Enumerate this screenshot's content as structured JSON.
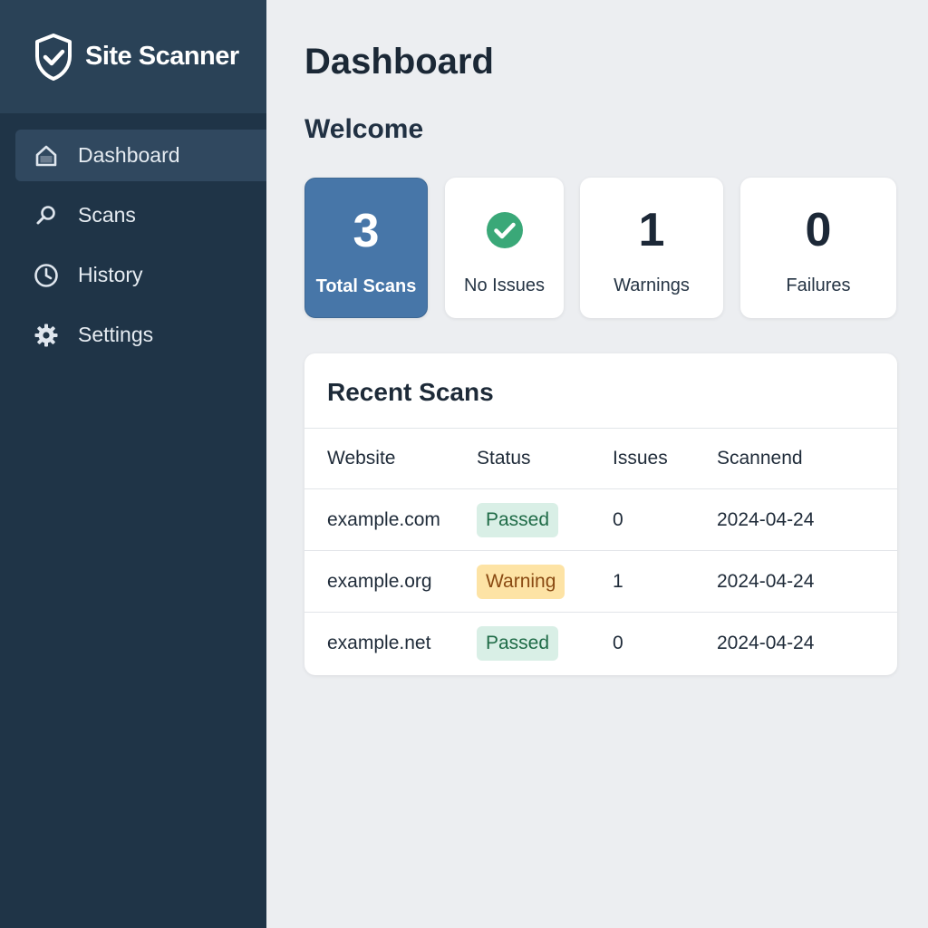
{
  "app": {
    "name": "Site Scanner",
    "logo_icon": "shield-check-icon"
  },
  "sidebar": {
    "items": [
      {
        "label": "Dashboard",
        "icon": "home-icon",
        "active": true
      },
      {
        "label": "Scans",
        "icon": "search-icon",
        "active": false
      },
      {
        "label": "History",
        "icon": "clock-icon",
        "active": false
      },
      {
        "label": "Settings",
        "icon": "gear-icon",
        "active": false
      }
    ]
  },
  "header": {
    "title": "Dashboard",
    "welcome": "Welcome"
  },
  "stats": [
    {
      "value": "3",
      "label": "Total Scans"
    },
    {
      "icon": "check-circle-icon",
      "label": "No Issues"
    },
    {
      "value": "1",
      "label": "Warnings"
    },
    {
      "value": "0",
      "label": "Failures"
    }
  ],
  "recent_scans": {
    "title": "Recent Scans",
    "columns": [
      "Website",
      "Status",
      "Issues",
      "Scannend"
    ],
    "rows": [
      {
        "website": "example.com",
        "status": "Passed",
        "issues": "0",
        "scanned": "2024-04-24"
      },
      {
        "website": "example.org",
        "status": "Warning",
        "issues": "1",
        "scanned": "2024-04-24"
      },
      {
        "website": "example.net",
        "status": "Passed",
        "issues": "0",
        "scanned": "2024-04-24"
      }
    ]
  },
  "colors": {
    "sidebar_bg": "#1f3447",
    "brand_bg": "#2a4257",
    "primary_card": "#4776a8",
    "success": "#3aa878",
    "passed_badge_bg": "#d9efe6",
    "warning_badge_bg": "#fde3a5"
  }
}
